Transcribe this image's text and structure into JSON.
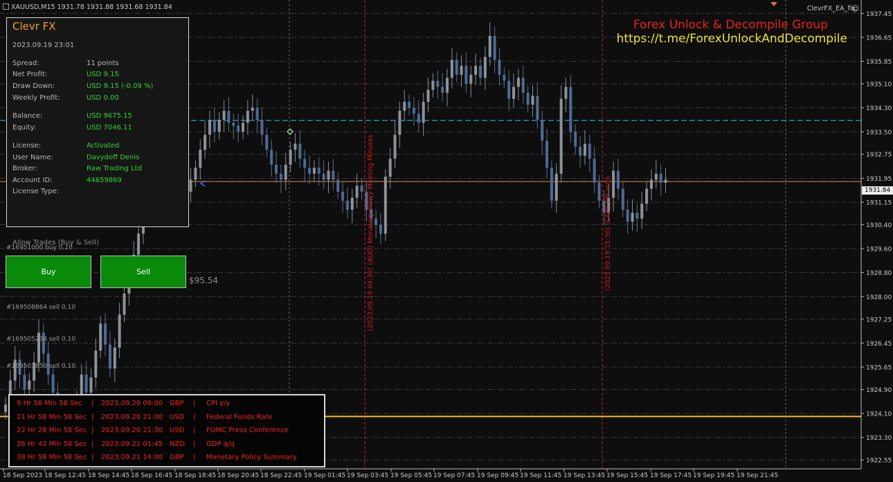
{
  "header": {
    "symbol_line": "XAUUSD,M15  1931.78 1931.88 1931.68 1931.84",
    "ea_name": "ClevrFX_EA_fix",
    "smiley": "☺"
  },
  "watermark": {
    "line1": "Forex Unlock & Decompile Group",
    "line2": "https://t.me/ForexUnlockAndDecompile"
  },
  "panel": {
    "title": "Clevr FX",
    "datetime": "2023.09.19 23:01",
    "rows": [
      {
        "label": "Spread:",
        "value": "11 points",
        "color": "#b8b8b8"
      },
      {
        "label": "Net Profit:",
        "value": "USD 9.15",
        "color": "#36d136"
      },
      {
        "label": "Draw Down:",
        "value": "USD 9.15 (-0.09 %)",
        "color": "#36d136"
      },
      {
        "label": "Weekly Profit:",
        "value": "USD 0.00",
        "color": "#36d136"
      },
      {
        "label": "Balance:",
        "value": "USD 9675.15",
        "color": "#36d136"
      },
      {
        "label": "Equity:",
        "value": "USD 7046.11",
        "color": "#36d136"
      },
      {
        "label": "License:",
        "value": "Activated",
        "color": "#36d136"
      },
      {
        "label": "User Name:",
        "value": "Davydoff Denis",
        "color": "#36d136"
      },
      {
        "label": "Broker:",
        "value": "Raw Trading Ltd",
        "color": "#36d136"
      },
      {
        "label": "Account ID:",
        "value": "44659869",
        "color": "#36d136"
      },
      {
        "label": "License Type:",
        "value": "",
        "color": "#36d136"
      }
    ]
  },
  "trading": {
    "allow_label": "Allow Trades (Buy & Sell)",
    "buy_label": "Buy",
    "sell_label": "Sell",
    "floating_profit": "$95.54"
  },
  "orders": [
    {
      "label": "#16951000 buy 0.10"
    },
    {
      "label": "#169508864 sell 0.10"
    },
    {
      "label": "#169505234 sell 0.10"
    },
    {
      "label": "#169501850 sell 0.10"
    }
  ],
  "news": [
    {
      "countdown": "9 Hr 58 Min 58 Sec",
      "datetime": "2023.09.20 09:00",
      "currency": "GBP",
      "event": "CPI y/y"
    },
    {
      "countdown": "21 Hr 58 Min 58 Sec",
      "datetime": "2023.09.20 21:00",
      "currency": "USD",
      "event": "Federal Funds Rate"
    },
    {
      "countdown": "22 Hr 28 Min 58 Sec",
      "datetime": "2023.09.20 21:30",
      "currency": "USD",
      "event": "FOMC Press Conference"
    },
    {
      "countdown": "26 Hr 43 Min 58 Sec",
      "datetime": "2023.09.21 01:45",
      "currency": "NZD",
      "event": "GDP q/q"
    },
    {
      "countdown": "38 Hr 58 Min 58 Sec",
      "datetime": "2023.09.21 14:00",
      "currency": "GBP",
      "event": "Monetary Policy Summary"
    }
  ],
  "news_separator": "|",
  "news_markers": [
    {
      "text": "(2023.09.19 04:30) (AUD) Monetary Policy Meeting Minutes"
    },
    {
      "text": "(2023.09.19 15:30) (CAD) CPI m/m"
    }
  ],
  "chart_data": {
    "type": "candlestick",
    "symbol": "XAUUSD",
    "timeframe": "M15",
    "bid": 1931.84,
    "ylim": [
      1922.3,
      1937.85
    ],
    "y_ticks": [
      "1937.45",
      "1936.65",
      "1935.85",
      "1935.10",
      "1934.30",
      "1933.50",
      "1932.75",
      "1931.95",
      "1931.15",
      "1930.40",
      "1929.60",
      "1928.80",
      "1928.00",
      "1927.25",
      "1926.45",
      "1925.65",
      "1924.90",
      "1924.10",
      "1923.30",
      "1922.55"
    ],
    "x_ticks": [
      "18 Sep 2023",
      "18 Sep 12:45",
      "18 Sep 14:45",
      "18 Sep 16:45",
      "18 Sep 18:45",
      "18 Sep 20:45",
      "18 Sep 22:45",
      "19 Sep 01:45",
      "19 Sep 03:45",
      "19 Sep 05:45",
      "19 Sep 07:45",
      "19 Sep 09:45",
      "19 Sep 11:45",
      "19 Sep 13:45",
      "19 Sep 15:45",
      "19 Sep 17:45",
      "19 Sep 19:45",
      "19 Sep 21:45"
    ],
    "close_path": [
      1924.4,
      1925.2,
      1925.9,
      1925.4,
      1924.9,
      1925.2,
      1925.8,
      1926.8,
      1926.1,
      1925.4,
      1924.8,
      1924.3,
      1923.8,
      1923.3,
      1923.7,
      1924.6,
      1925.4,
      1924.8,
      1925.3,
      1926.2,
      1927.1,
      1926.4,
      1925.6,
      1926.3,
      1927.4,
      1928.1,
      1928.7,
      1929.4,
      1930.1,
      1930.8,
      1931.6,
      1932.3,
      1932.7,
      1932.1,
      1931.7,
      1931.3,
      1931.5,
      1931.7,
      1931.5,
      1931.9,
      1932.3,
      1932.9,
      1933.4,
      1933.9,
      1933.5,
      1933.9,
      1934.2,
      1933.8,
      1933.7,
      1933.5,
      1933.8,
      1934.2,
      1934.3,
      1933.9,
      1933.4,
      1932.9,
      1932.4,
      1932.1,
      1931.9,
      1932.4,
      1932.9,
      1933.1,
      1932.6,
      1932.3,
      1932.1,
      1932.3,
      1932.1,
      1931.9,
      1932.2,
      1931.9,
      1931.5,
      1931.2,
      1930.9,
      1931.3,
      1931.7,
      1931.5,
      1930.9,
      1930.6,
      1930.4,
      1930.1,
      1932.0,
      1932.6,
      1933.4,
      1934.2,
      1934.5,
      1934.3,
      1934.1,
      1933.8,
      1934.5,
      1934.9,
      1935.2,
      1935.0,
      1934.8,
      1935.3,
      1935.9,
      1935.4,
      1935.7,
      1935.1,
      1935.4,
      1935.7,
      1935.3,
      1936.0,
      1936.7,
      1935.9,
      1935.4,
      1935.2,
      1934.6,
      1935.0,
      1935.3,
      1934.8,
      1934.4,
      1934.7,
      1933.9,
      1933.2,
      1932.3,
      1931.2,
      1932.1,
      1934.6,
      1935.0,
      1933.5,
      1933.0,
      1932.7,
      1933.1,
      1932.6,
      1931.8,
      1931.2,
      1930.8,
      1931.3,
      1932.2,
      1931.6,
      1930.9,
      1930.5,
      1930.8,
      1930.6,
      1931.1,
      1931.6,
      1931.9,
      1932.1,
      1931.8,
      1931.9
    ]
  },
  "levels": [
    {
      "price": 1933.88,
      "color": "#38c8e6",
      "style": "dashed"
    },
    {
      "price": 1931.84,
      "color": "#d98a5c",
      "style": "solid"
    },
    {
      "price": 1924.0,
      "color": "#f0c419",
      "style": "solid"
    }
  ]
}
